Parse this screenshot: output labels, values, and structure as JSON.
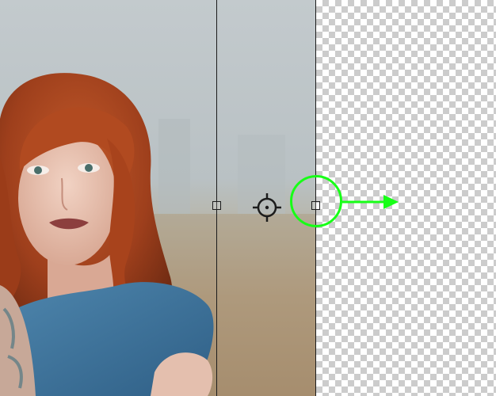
{
  "canvas": {
    "document": "portrait photo",
    "transparent_background": true
  },
  "colors": {
    "annotation": "#17ff17",
    "guide": "#1c1c1c",
    "checker_dark": "#cccccc",
    "checker_light": "#ffffff"
  },
  "icons": {
    "reference_point": "crosshair-icon",
    "side_handle": "square-handle-icon",
    "drag_direction": "arrow-right-icon"
  }
}
